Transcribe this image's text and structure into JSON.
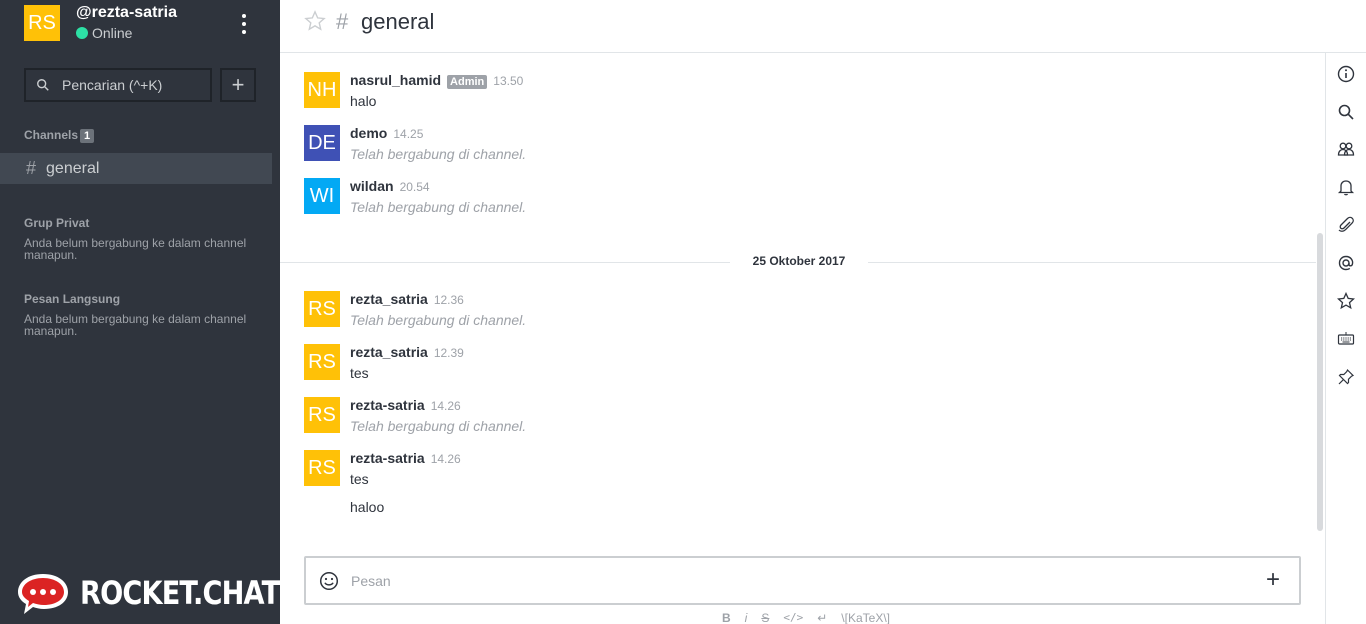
{
  "user": {
    "initials": "RS",
    "username": "@rezta-satria",
    "status": "Online",
    "avatar_color": "#ffc107",
    "status_color": "#2de0a5"
  },
  "sidebar": {
    "search_placeholder": "Pencarian (^+K)",
    "channels_title": "Channels",
    "channels_count": "1",
    "channels": [
      {
        "label": "general"
      }
    ],
    "private_title": "Grup Privat",
    "private_empty": "Anda belum bergabung ke dalam channel manapun.",
    "direct_title": "Pesan Langsung",
    "direct_empty": "Anda belum bergabung ke dalam channel manapun.",
    "logo_text": "ROCKET.CHAT",
    "bg_color": "#2f343d"
  },
  "header": {
    "title": "general"
  },
  "messages": [
    {
      "initials": "NH",
      "user": "nasrul_hamid",
      "role": "Admin",
      "time": "13.50",
      "body": "halo",
      "system": false,
      "color": "#ffc107"
    },
    {
      "initials": "DE",
      "user": "demo",
      "time": "14.25",
      "body": "Telah bergabung di channel.",
      "system": true,
      "color": "#3f51b5"
    },
    {
      "initials": "WI",
      "user": "wildan",
      "time": "20.54",
      "body": "Telah bergabung di channel.",
      "system": true,
      "color": "#03a9f4"
    },
    {
      "initials": "RS",
      "user": "rezta_satria",
      "time": "12.36",
      "body": "Telah bergabung di channel.",
      "system": true,
      "color": "#ffc107"
    },
    {
      "initials": "RS",
      "user": "rezta_satria",
      "time": "12.39",
      "body": "tes",
      "system": false,
      "color": "#ffc107"
    },
    {
      "initials": "RS",
      "user": "rezta-satria",
      "time": "14.26",
      "body": "Telah bergabung di channel.",
      "system": true,
      "color": "#ffc107"
    },
    {
      "initials": "RS",
      "user": "rezta-satria",
      "time": "14.26",
      "body": "tes",
      "followup": "haloo",
      "system": false,
      "color": "#ffc107"
    }
  ],
  "day_divider": "25 Oktober 2017",
  "composer": {
    "placeholder": "Pesan",
    "format_bar": [
      "B",
      "i",
      "S",
      "</>",
      "↵",
      "\\[KaTeX\\]"
    ]
  },
  "rightbar_icons": [
    "info-icon",
    "search-icon",
    "members-icon",
    "bell-icon",
    "paperclip-icon",
    "mention-icon",
    "star-icon",
    "keyboard-icon",
    "pin-icon"
  ]
}
